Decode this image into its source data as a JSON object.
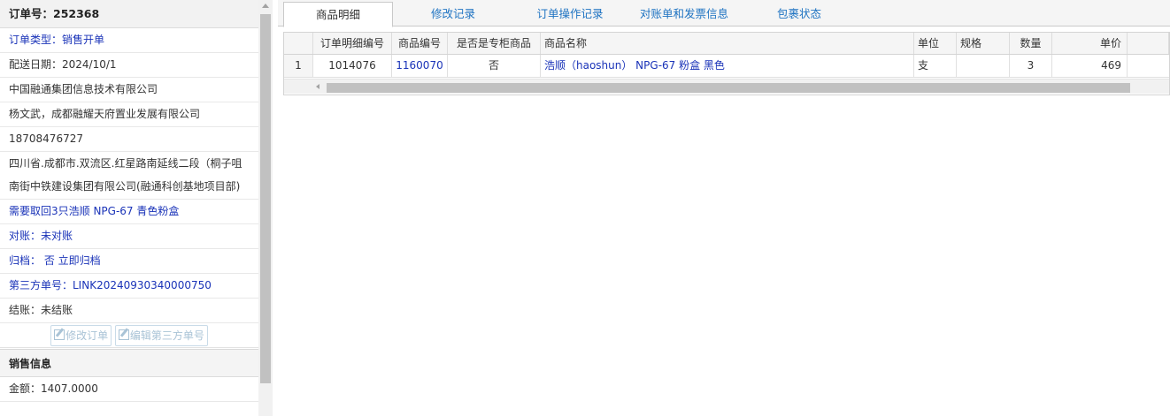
{
  "left": {
    "order_number_label": "订单号：",
    "order_number": "252368",
    "rows": [
      {
        "text": "订单类型：销售开单",
        "blue": true
      },
      {
        "text": "配送日期：2024/10/1",
        "blue": false
      },
      {
        "text": "中国融通集团信息技术有限公司",
        "blue": false
      },
      {
        "text": "杨文武，成都融耀天府置业发展有限公司",
        "blue": false
      },
      {
        "text": "18708476727",
        "blue": false
      }
    ],
    "address": "四川省.成都市.双流区.红星路南延线二段（桐子咀南街中铁建设集团有限公司(融通科创基地项目部)",
    "note": "需要取回3只浩顺 NPG-67 青色粉盒",
    "reconciliation": "对账：未对账",
    "archive": "归档： 否 立即归档",
    "third_party": "第三方单号：LINK20240930340000750",
    "settlement": "结账：未结账",
    "edit_order_button": "修改订单",
    "edit_third_party_button": "编辑第三方单号",
    "sales_section_title": "销售信息",
    "amount": "金额：1407.0000"
  },
  "tabs": [
    {
      "label": "商品明细",
      "active": true
    },
    {
      "label": "修改记录",
      "active": false
    },
    {
      "label": "订单操作记录",
      "active": false
    },
    {
      "label": "对账单和发票信息",
      "active": false
    },
    {
      "label": "包裹状态",
      "active": false
    }
  ],
  "grid": {
    "columns": [
      "",
      "订单明细编号",
      "商品编号",
      "是否是专柜商品",
      "商品名称",
      "单位",
      "规格",
      "数量",
      "单价"
    ],
    "rows": [
      {
        "index": "1",
        "detail_no": "1014076",
        "product_code": "1160070",
        "exclusive": "否",
        "name": "浩顺（haoshun） NPG-67 粉盒 黑色",
        "unit": "支",
        "spec": "",
        "qty": "3",
        "price": "469"
      }
    ]
  }
}
